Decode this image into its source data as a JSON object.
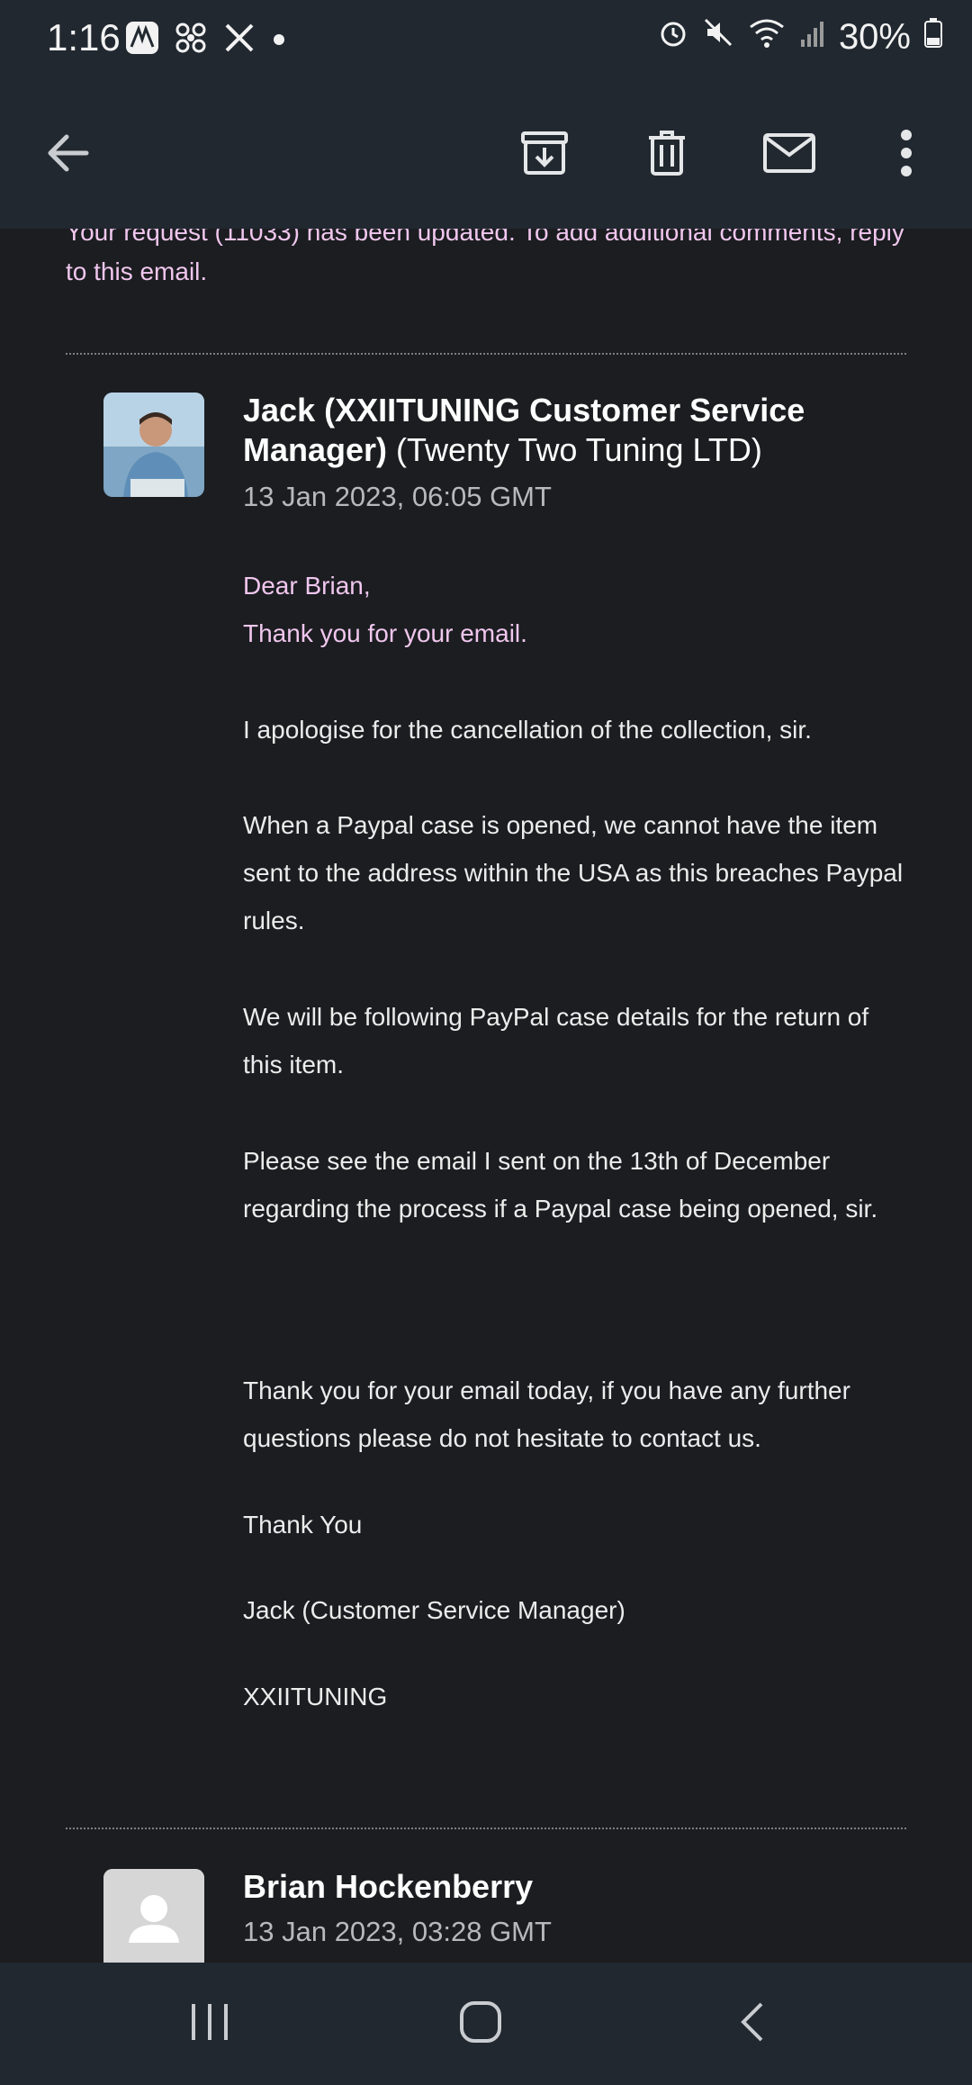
{
  "status": {
    "time": "1:16",
    "battery": "30%"
  },
  "toolbar": {
    "back_icon": "arrow-left-icon",
    "archive_icon": "archive-icon",
    "delete_icon": "trash-icon",
    "mark_unread_icon": "mail-icon",
    "more_icon": "more-vert-icon"
  },
  "intro_text": "Your request (11033) has been updated. To add additional comments, reply to this email.",
  "message1": {
    "sender_name": "Jack (XXIITUNING Customer Service Manager)",
    "sender_org": "(Twenty Two Tuning LTD)",
    "date": "13 Jan 2023, 06:05 GMT",
    "greeting": "Dear Brian,",
    "thanks": "Thank you for your email.",
    "p1": "I apologise for the cancellation of the collection, sir.",
    "p2": "When a Paypal case is opened, we cannot have the item sent to the address within the USA as this breaches Paypal rules.",
    "p3": "We will be following PayPal case details for the return of this item.",
    "p4": "Please see the email I sent on the 13th of December regarding the process if a Paypal case being opened, sir.",
    "p5": "Thank you for your email today, if you have any further questions please do not hesitate to contact us.",
    "sign1": "Thank You",
    "sign2": "Jack (Customer Service Manager)",
    "sign3": "XXIITUNING"
  },
  "message2": {
    "sender_name": "Brian Hockenberry",
    "date": "13 Jan 2023, 03:28 GMT"
  },
  "colors": {
    "background": "#1b1d20",
    "bar": "#212830",
    "quoted_text": "#f0c6ee"
  }
}
